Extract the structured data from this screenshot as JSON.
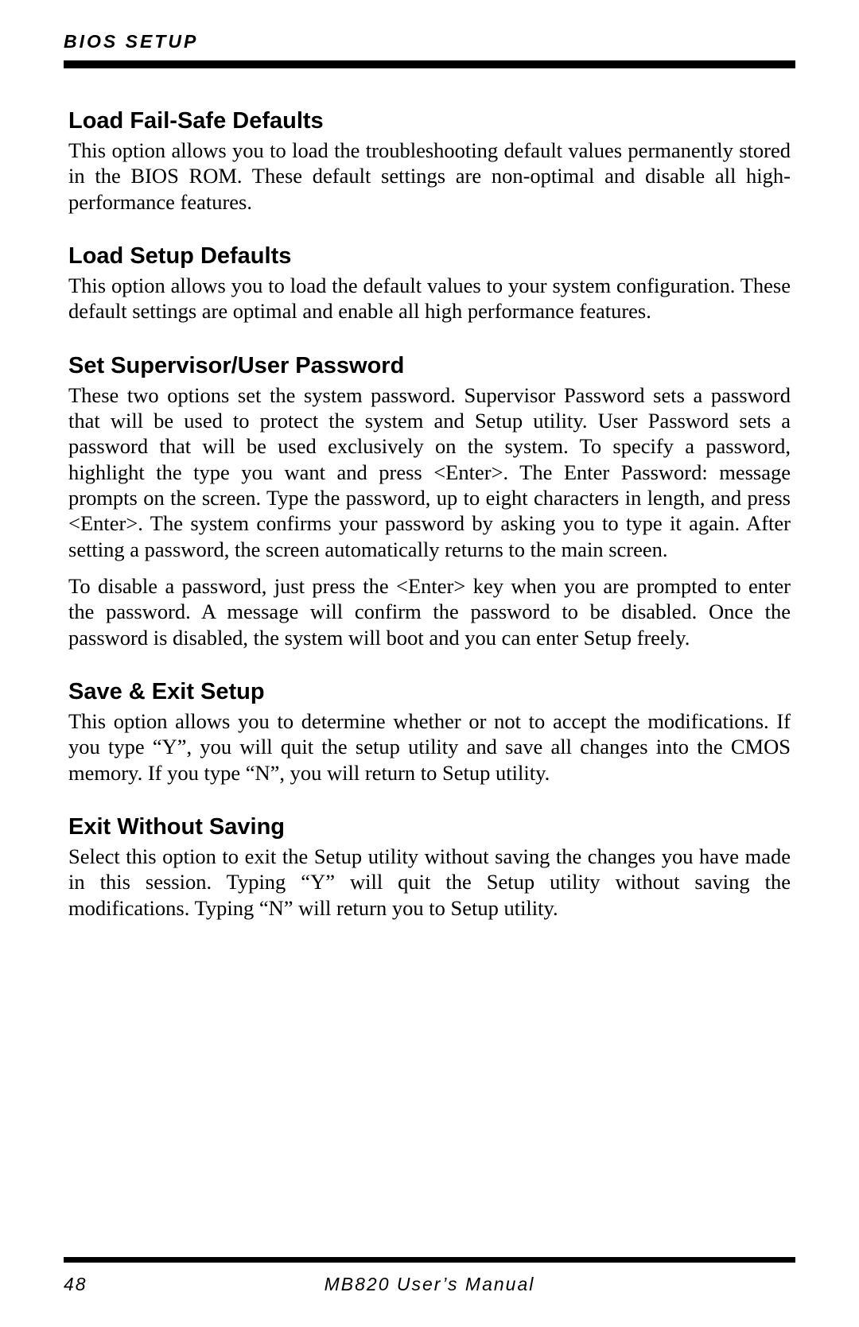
{
  "header": {
    "label": "BIOS SETUP"
  },
  "sections": [
    {
      "heading": "Load Fail-Safe Defaults",
      "paragraphs": [
        "This option allows you to load the troubleshooting default values permanently stored in the BIOS ROM. These default settings are non-optimal and disable all high-performance features."
      ]
    },
    {
      "heading": "Load Setup Defaults",
      "paragraphs": [
        "This option allows you to load the default values to your system configuration. These default settings are optimal and enable all high performance features."
      ]
    },
    {
      "heading": "Set Supervisor/User Password",
      "paragraphs": [
        "These two options set the system password. Supervisor Password sets a password that will be used to protect the system and Setup utility. User Password sets a password that will be used exclusively on the system. To specify a password, highlight the type you want and press <Enter>. The Enter Password: message prompts on the screen. Type the password, up to eight characters in length, and press <Enter>. The system confirms your password by asking you to type it again. After setting a password, the screen automatically returns to the main screen.",
        "To disable a password, just press the <Enter> key when you are prompted to enter the password. A message will confirm the password to be disabled. Once the password is disabled, the system will boot and you can enter Setup freely."
      ]
    },
    {
      "heading": "Save & Exit Setup",
      "paragraphs": [
        "This option allows you to determine whether or not to accept the modifications. If you type “Y”, you will quit the setup utility and save all changes into the CMOS memory. If you type “N”, you will return to Setup utility."
      ]
    },
    {
      "heading": "Exit Without Saving",
      "paragraphs": [
        "Select this option to exit the Setup utility without saving the changes you have made in this session. Typing “Y” will quit the Setup utility without saving the modifications. Typing “N” will return you to Setup utility."
      ]
    }
  ],
  "footer": {
    "page_number": "48",
    "title": "MB820 User’s Manual"
  }
}
